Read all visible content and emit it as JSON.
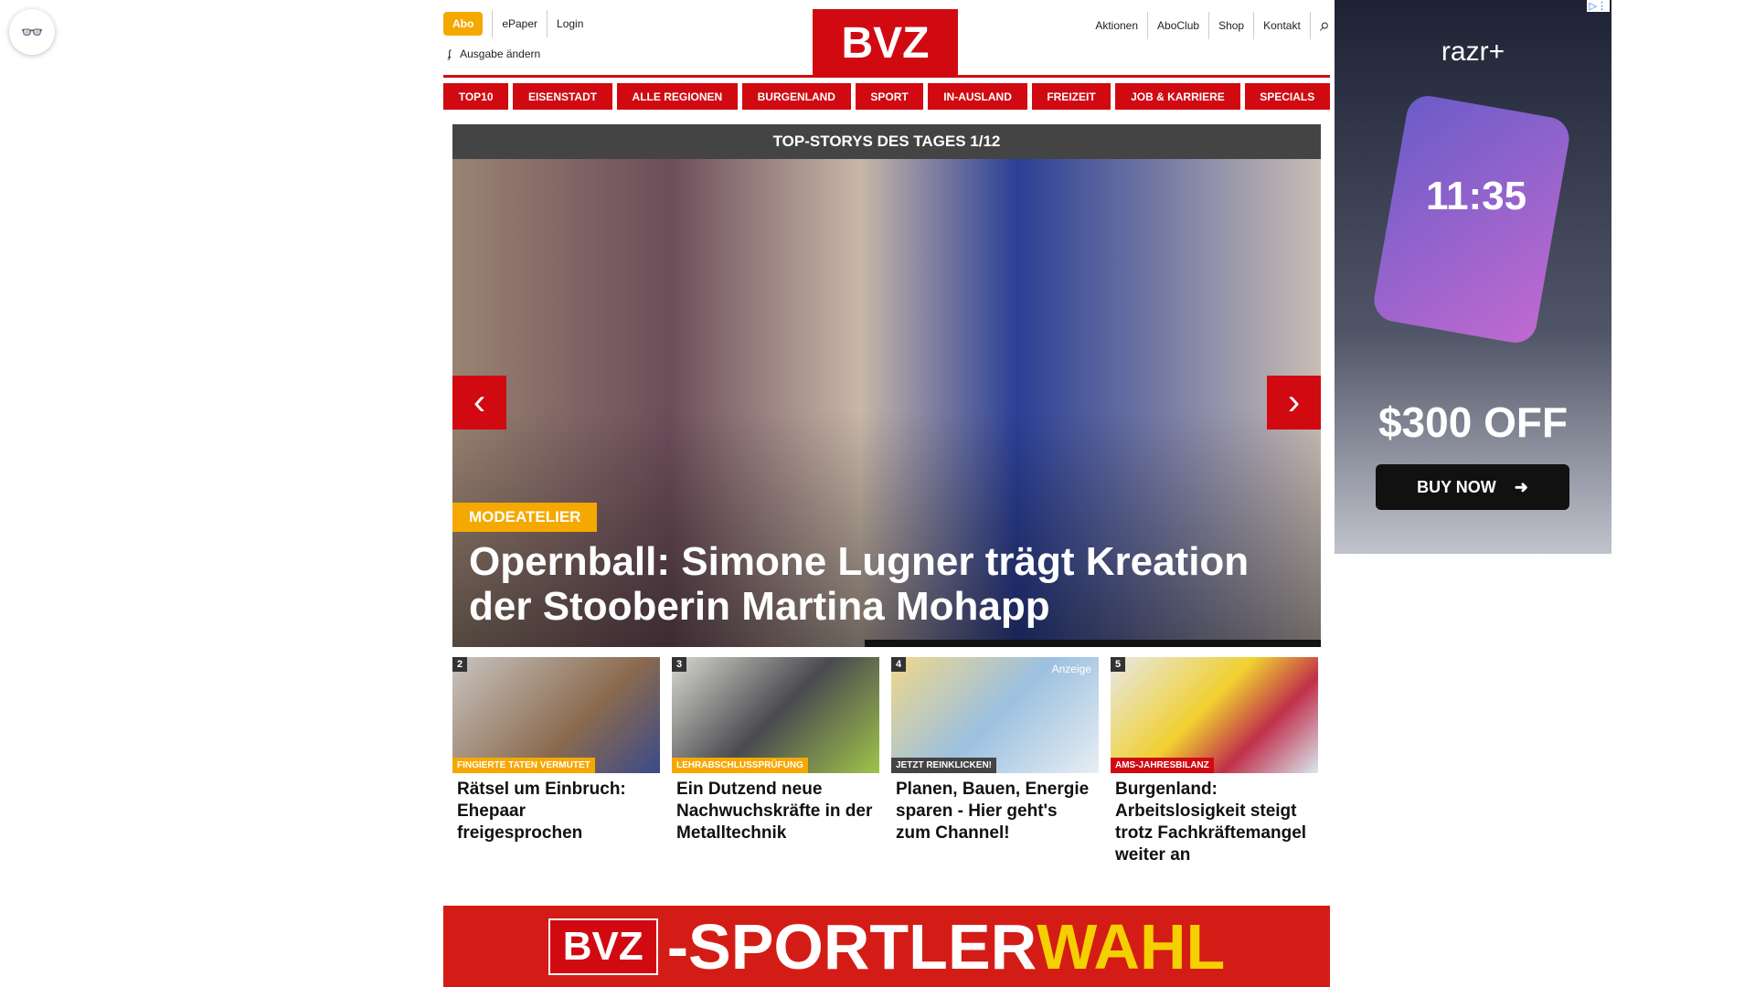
{
  "reader_icon": "glasses-icon",
  "header": {
    "abo": "Abo",
    "epaper": "ePaper",
    "login": "Login",
    "ausgabe": "Ausgabe ändern",
    "logo": "BVZ",
    "right_links": [
      "Aktionen",
      "AboClub",
      "Shop",
      "Kontakt"
    ]
  },
  "nav": [
    "TOP10",
    "EISENSTADT",
    "ALLE REGIONEN",
    "BURGENLAND",
    "SPORT",
    "IN-AUSLAND",
    "FREIZEIT",
    "JOB & KARRIERE",
    "SPECIALS"
  ],
  "hero": {
    "bar": "TOP-STORYS DES TAGES 1/12",
    "kicker": "MODEATELIER",
    "title": "Opernball: Simone Lugner trägt Kreation der Stooberin Martina Mohapp"
  },
  "cards": [
    {
      "num": "2",
      "kicker": "FINGIERTE TATEN VERMUTET",
      "title": "Rätsel um Einbruch: Ehepaar freigesprochen",
      "color": "#f5a800"
    },
    {
      "num": "3",
      "kicker": "LEHRABSCHLUSSPRÜFUNG",
      "title": "Ein Dutzend neue Nachwuchskräfte in der Metalltechnik",
      "color": "#f5a800"
    },
    {
      "num": "4",
      "kicker": "JETZT REINKLICKEN!",
      "title": "Planen, Bauen, Energie sparen - Hier geht's zum Channel!",
      "color": "#444",
      "badge": "Anzeige"
    },
    {
      "num": "5",
      "kicker": "AMS-JAHRESBILANZ",
      "title": "Burgenland: Arbeitslosigkeit steigt trotz Fachkräftemangel weiter an",
      "color": "#d10a11"
    }
  ],
  "banner": {
    "logo": "BVZ",
    "text1": "-SPORTLER",
    "text2": "WAHL"
  },
  "ad": {
    "brand": "razr+",
    "time": "11:35",
    "offer": "$300 OFF",
    "button": "BUY NOW"
  },
  "colors": {
    "brand": "#d10a11",
    "accent": "#f5a800"
  }
}
